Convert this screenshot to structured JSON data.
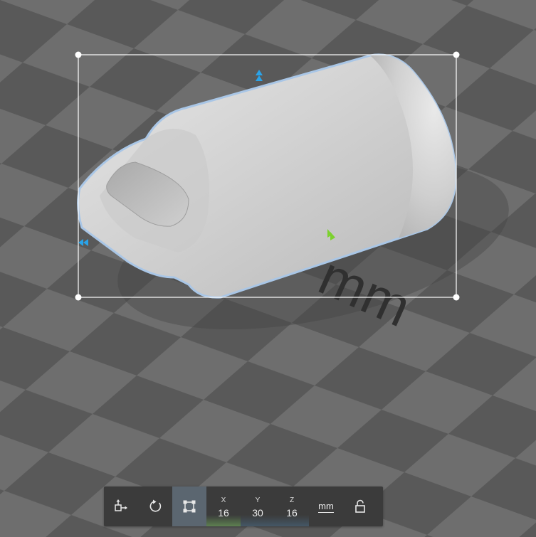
{
  "scene": {
    "floor_text": "mm",
    "colors": {
      "floor_light": "#747474",
      "floor_dark": "#545454",
      "model": "#d4d4d4",
      "model_outline": "#a9c6e6",
      "handle_blue": "#2aa3e8",
      "handle_green": "#7cd12e",
      "bbox": "#ffffff"
    }
  },
  "toolbar": {
    "move_icon": "move-icon",
    "rotate_icon": "rotate-icon",
    "scale_icon": "scale-icon",
    "dimensions": [
      {
        "axis": "X",
        "value": "16"
      },
      {
        "axis": "Y",
        "value": "30"
      },
      {
        "axis": "Z",
        "value": "16"
      }
    ],
    "unit_label": "mm",
    "lock_icon": "lock-icon"
  }
}
